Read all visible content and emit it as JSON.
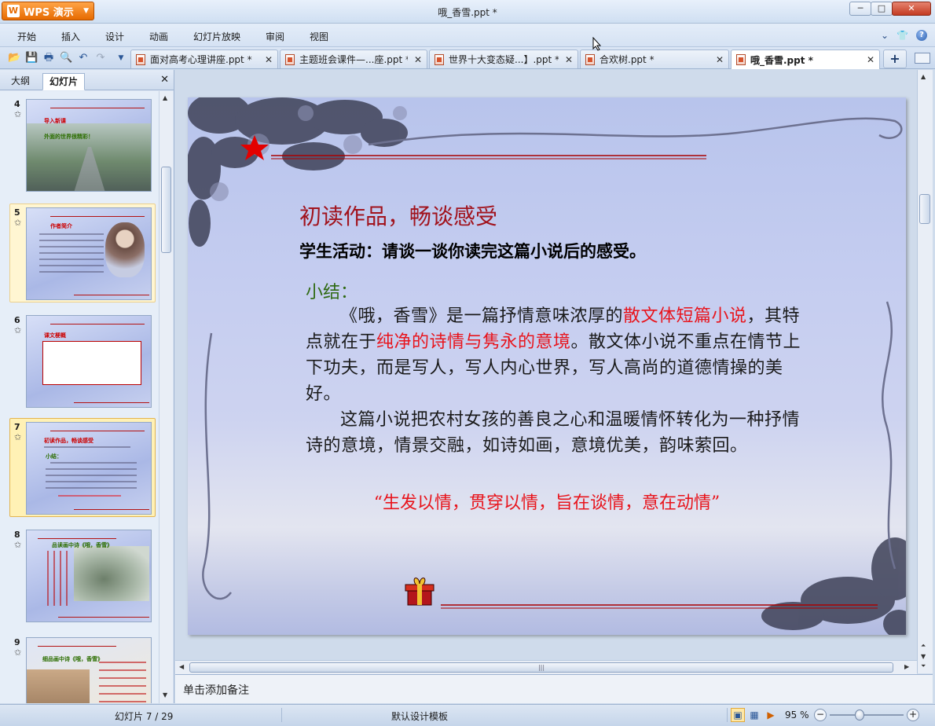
{
  "app": {
    "brand": "WPS 演示",
    "window_title": "哦_香雪.ppt *",
    "window_controls": {
      "minimize": "─",
      "maximize": "□",
      "close": "✕"
    }
  },
  "menu": {
    "items": [
      "开始",
      "插入",
      "设计",
      "动画",
      "幻灯片放映",
      "审阅",
      "视图"
    ],
    "right_icons": [
      "chevron-down-icon",
      "shirt-icon",
      "help-icon"
    ]
  },
  "toolbar": {
    "icons": [
      "open-icon",
      "save-icon",
      "print-icon",
      "print-preview-icon",
      "undo-icon",
      "redo-icon",
      "customize-dropdown-icon"
    ]
  },
  "tabs": [
    {
      "label": "面对高考心理讲座.ppt *",
      "active": false
    },
    {
      "label": "主题班会课件—...座.ppt *",
      "active": false
    },
    {
      "label": "世界十大变态疑...】.ppt *",
      "active": false
    },
    {
      "label": "合欢树.ppt *",
      "active": false
    },
    {
      "label": "哦_香雪.ppt *",
      "active": true
    }
  ],
  "new_tab_label": "+",
  "panel": {
    "tab_outline": "大纲",
    "tab_slides": "幻灯片",
    "close": "✕",
    "thumbnails": [
      {
        "number": "4",
        "heading": "导入新课",
        "caption": "外面的世界很精彩！",
        "state": "normal"
      },
      {
        "number": "5",
        "heading": "作者简介",
        "caption": "",
        "state": "highlighted"
      },
      {
        "number": "6",
        "heading": "课文梗概",
        "caption": "",
        "state": "normal"
      },
      {
        "number": "7",
        "heading": "初读作品，畅谈感受",
        "caption": "小结：",
        "state": "selected"
      },
      {
        "number": "8",
        "heading": "品读画中诗《哦，香雪》",
        "caption": "",
        "state": "normal"
      },
      {
        "number": "9",
        "heading": "细品画中诗《哦，香雪》",
        "caption": "",
        "state": "normal"
      }
    ]
  },
  "slide": {
    "title": "初读作品，畅谈感受",
    "activity": "学生活动：请谈一谈你读完这篇小说后的感受。",
    "summary_label": "小结：",
    "para1": {
      "a": "《哦，香雪》是一篇抒情意味浓厚的",
      "b": "散文体短篇小说",
      "c": "，其特点就在于",
      "d": "纯净的诗情与隽永的意境",
      "e": "。散文体小说不重点在情节上下功夫，而是写人，写人内心世界，写人高尚的道德情操的美好。"
    },
    "para2": "这篇小说把农村女孩的善良之心和温暖情怀转化为一种抒情诗的意境，情景交融，如诗如画，意境优美，韵味萦回。",
    "quote": "“生发以情，贯穿以情，旨在谈情，意在动情”"
  },
  "notes_placeholder": "单击添加备注",
  "status": {
    "page": "幻灯片 7 / 29",
    "template": "默认设计模板",
    "zoom": "95 %",
    "zoom_minus": "−",
    "zoom_plus": "+",
    "zoom_level": 0.4
  },
  "colors": {
    "accent": "#e66a00",
    "slide_title": "#a1131d",
    "slide_highlight": "#e8141c",
    "summary": "#2f6a12"
  }
}
